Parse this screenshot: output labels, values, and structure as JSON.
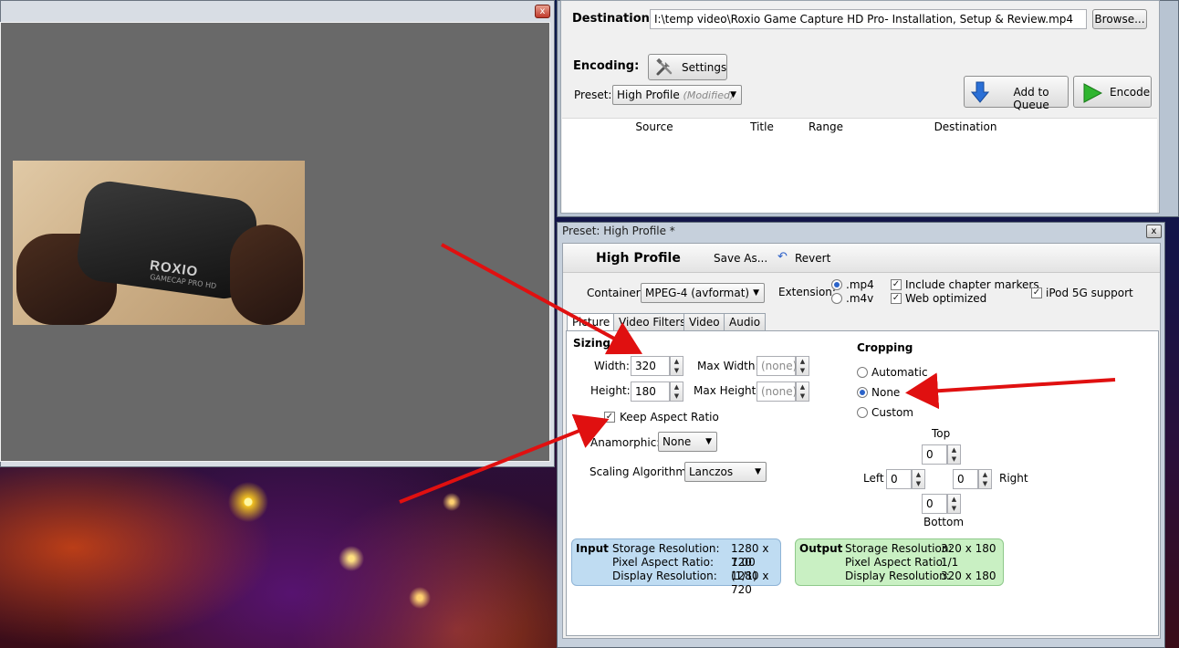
{
  "preview": {
    "close_glyph": "x",
    "video_logo": "ROXIO",
    "video_sublogo": "GAMECAP PRO HD"
  },
  "main": {
    "destination_label": "Destination:",
    "destination_value": "I:\\temp video\\Roxio Game Capture HD Pro- Installation, Setup & Review.mp4",
    "browse_label": "Browse...",
    "encoding_label": "Encoding:",
    "settings_label": "Settings",
    "preset_label": "Preset:",
    "preset_value": "High Profile",
    "preset_modified": "(Modified)",
    "add_to_queue_label": "Add to Queue",
    "encode_label": "Encode",
    "queue_columns": [
      "Source",
      "Title",
      "Range",
      "Destination"
    ]
  },
  "preset": {
    "window_title": "Preset: High Profile *",
    "close_glyph": "x",
    "name": "High Profile",
    "save_as_label": "Save As...",
    "revert_label": "Revert",
    "container_label": "Container:",
    "container_value": "MPEG-4 (avformat)",
    "extension_label": "Extension:",
    "ext_mp4": ".mp4",
    "ext_m4v": ".m4v",
    "include_chapter_markers": "Include chapter markers",
    "web_optimized": "Web optimized",
    "ipod_support": "iPod 5G support",
    "tabs": [
      "Picture",
      "Video Filters",
      "Video",
      "Audio"
    ],
    "sizing_title": "Sizing",
    "width_label": "Width:",
    "width_value": "320",
    "height_label": "Height:",
    "height_value": "180",
    "max_width_label": "Max Width:",
    "max_width_value": "(none)",
    "max_height_label": "Max Height:",
    "max_height_value": "(none)",
    "keep_aspect_label": "Keep Aspect Ratio",
    "anamorphic_label": "Anamorphic:",
    "anamorphic_value": "None",
    "scaling_label": "Scaling Algorithm:",
    "scaling_value": "Lanczos",
    "cropping_title": "Cropping",
    "crop_automatic": "Automatic",
    "crop_none": "None",
    "crop_custom": "Custom",
    "crop_top_label": "Top",
    "crop_left_label": "Left",
    "crop_right_label": "Right",
    "crop_bottom_label": "Bottom",
    "crop_top": "0",
    "crop_left": "0",
    "crop_right": "0",
    "crop_bottom": "0",
    "input_title": "Input",
    "output_title": "Output",
    "storage_res_label": "Storage Resolution:",
    "pixel_ar_label": "Pixel Aspect Ratio:",
    "display_res_label": "Display Resolution:",
    "input_storage": "1280 x 720",
    "input_par": "1.00 (1/1)",
    "input_display": "1280 x 720",
    "output_storage": "320 x 180",
    "output_par": "1/1",
    "output_display": "320 x 180"
  },
  "colors": {
    "arrow": "#e01010"
  }
}
